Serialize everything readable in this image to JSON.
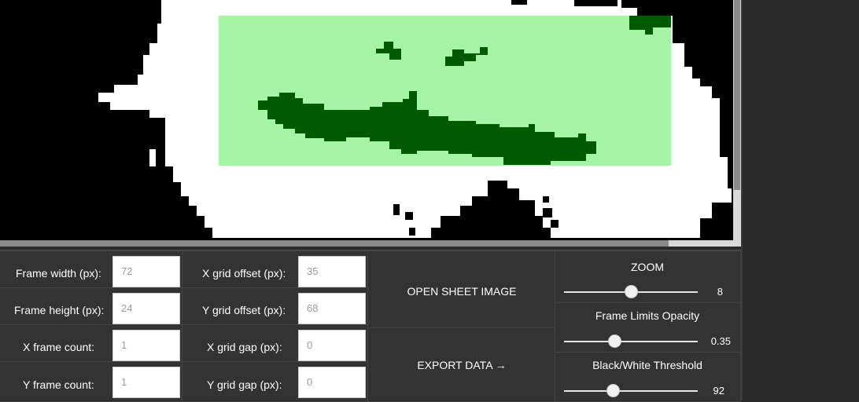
{
  "fields": {
    "frame_width": {
      "label": "Frame width (px):",
      "value": "72"
    },
    "frame_height": {
      "label": "Frame height (px):",
      "value": "24"
    },
    "x_frame_count": {
      "label": "X frame count:",
      "value": "1"
    },
    "y_frame_count": {
      "label": "Y frame count:",
      "value": "1"
    },
    "x_grid_offset": {
      "label": "X grid offset (px):",
      "value": "35"
    },
    "y_grid_offset": {
      "label": "Y grid offset (px):",
      "value": "68"
    },
    "x_grid_gap": {
      "label": "X grid gap (px):",
      "value": "0"
    },
    "y_grid_gap": {
      "label": "Y grid gap (px):",
      "value": "0"
    }
  },
  "actions": {
    "open_sheet": "OPEN SHEET IMAGE",
    "export": "EXPORT DATA →"
  },
  "sliders": {
    "zoom": {
      "title": "ZOOM",
      "value": "8",
      "position": 0.5
    },
    "opacity": {
      "title": "Frame Limits Opacity",
      "value": "0.35",
      "position": 0.38
    },
    "threshold": {
      "title": "Black/White Threshold",
      "value": "92",
      "position": 0.37
    }
  },
  "colors": {
    "frame_overlay": "#a6f5a6",
    "ink_in_frame": "#005a00",
    "sprite": "#ffffff",
    "background": "#000000"
  }
}
